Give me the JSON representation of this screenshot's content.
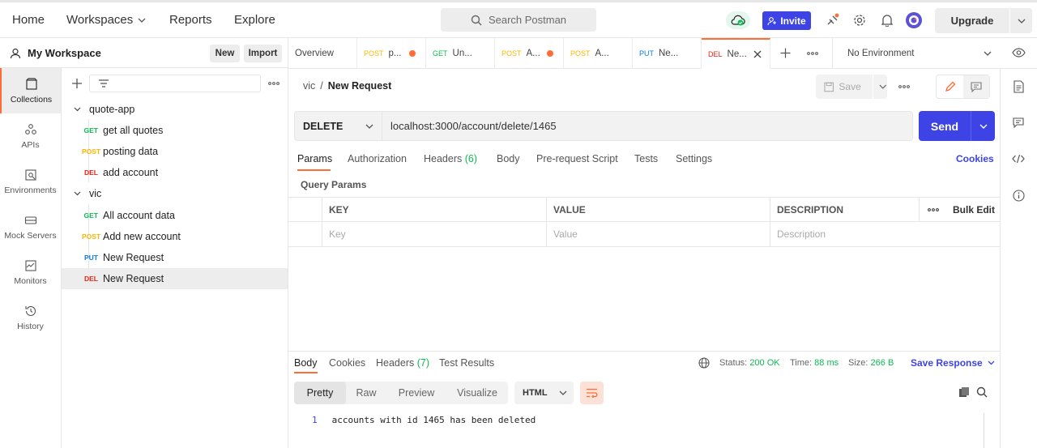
{
  "topnav": {
    "home": "Home",
    "workspaces": "Workspaces",
    "reports": "Reports",
    "explore": "Explore",
    "search_placeholder": "Search Postman",
    "invite": "Invite",
    "upgrade": "Upgrade"
  },
  "workspace": {
    "title": "My Workspace",
    "new": "New",
    "import": "Import"
  },
  "rail": [
    {
      "label": "Collections",
      "icon": "collections-icon"
    },
    {
      "label": "APIs",
      "icon": "apis-icon"
    },
    {
      "label": "Environments",
      "icon": "environments-icon"
    },
    {
      "label": "Mock Servers",
      "icon": "mock-servers-icon"
    },
    {
      "label": "Monitors",
      "icon": "monitors-icon"
    },
    {
      "label": "History",
      "icon": "history-icon"
    }
  ],
  "tree": [
    {
      "type": "folder",
      "label": "quote-app"
    },
    {
      "type": "req",
      "method": "GET",
      "label": "get all quotes"
    },
    {
      "type": "req",
      "method": "POST",
      "label": "posting data"
    },
    {
      "type": "req",
      "method": "DEL",
      "label": "add account"
    },
    {
      "type": "folder",
      "label": "vic"
    },
    {
      "type": "req",
      "method": "GET",
      "label": "All account data"
    },
    {
      "type": "req",
      "method": "POST",
      "label": "Add new account"
    },
    {
      "type": "req",
      "method": "PUT",
      "label": "New Request"
    },
    {
      "type": "req",
      "method": "DEL",
      "label": "New Request"
    }
  ],
  "tabs": [
    {
      "label": "Overview",
      "method": ""
    },
    {
      "method": "POST",
      "label": "p..."
    },
    {
      "method": "GET",
      "label": "Un..."
    },
    {
      "method": "POST",
      "label": "A..."
    },
    {
      "method": "POST",
      "label": "A..."
    },
    {
      "method": "PUT",
      "label": "Ne..."
    },
    {
      "method": "DEL",
      "label": "Ne..."
    }
  ],
  "environment": "No Environment",
  "breadcrumb": {
    "parent": "vic",
    "sep": "/",
    "current": "New Request"
  },
  "save_label": "Save",
  "request": {
    "method": "DELETE",
    "url": "localhost:3000/account/delete/1465",
    "send": "Send"
  },
  "req_tabs": {
    "params": "Params",
    "auth": "Authorization",
    "headers": "Headers",
    "headers_count": "(6)",
    "body": "Body",
    "prereq": "Pre-request Script",
    "tests": "Tests",
    "settings": "Settings",
    "cookies": "Cookies"
  },
  "query_params": {
    "title": "Query Params",
    "key": "KEY",
    "value": "VALUE",
    "description": "DESCRIPTION",
    "bulk_edit": "Bulk Edit",
    "key_ph": "Key",
    "value_ph": "Value",
    "desc_ph": "Description"
  },
  "response": {
    "tabs": {
      "body": "Body",
      "cookies": "Cookies",
      "headers": "Headers",
      "headers_count": "(7)",
      "tests": "Test Results"
    },
    "status_label": "Status:",
    "status": "200 OK",
    "time_label": "Time:",
    "time": "88 ms",
    "size_label": "Size:",
    "size": "266 B",
    "save": "Save Response",
    "views": [
      "Pretty",
      "Raw",
      "Preview",
      "Visualize"
    ],
    "format": "HTML",
    "line_no": "1",
    "body": "accounts with id 1465 has been deleted"
  },
  "colors": {
    "accent": "#ff6c37",
    "primary": "#3e43e5",
    "success": "#0cbb52"
  }
}
